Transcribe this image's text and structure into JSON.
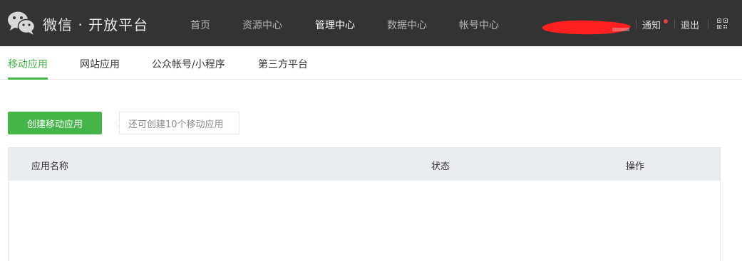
{
  "header": {
    "brand": "微信 · 开放平台",
    "nav": [
      {
        "label": "首页",
        "active": false
      },
      {
        "label": "资源中心",
        "active": false
      },
      {
        "label": "管理中心",
        "active": true
      },
      {
        "label": "数据中心",
        "active": false
      },
      {
        "label": "帐号中心",
        "active": false
      }
    ],
    "notice_label": "通知",
    "logout_label": "退出",
    "icons": [
      "wechat-logo",
      "qrcode-icon"
    ],
    "notice_dot_color": "#e64340"
  },
  "subnav": {
    "tabs": [
      {
        "label": "移动应用",
        "active": true
      },
      {
        "label": "网站应用",
        "active": false
      },
      {
        "label": "公众帐号/小程序",
        "active": false
      },
      {
        "label": "第三方平台",
        "active": false
      }
    ]
  },
  "actions": {
    "create_label": "创建移动应用",
    "tip_text": "还可创建10个移动应用"
  },
  "table": {
    "columns": [
      "应用名称",
      "状态",
      "操作"
    ],
    "rows": []
  },
  "colors": {
    "accent": "#44b549",
    "topbar": "#333333",
    "table_header": "#e9edf2"
  }
}
